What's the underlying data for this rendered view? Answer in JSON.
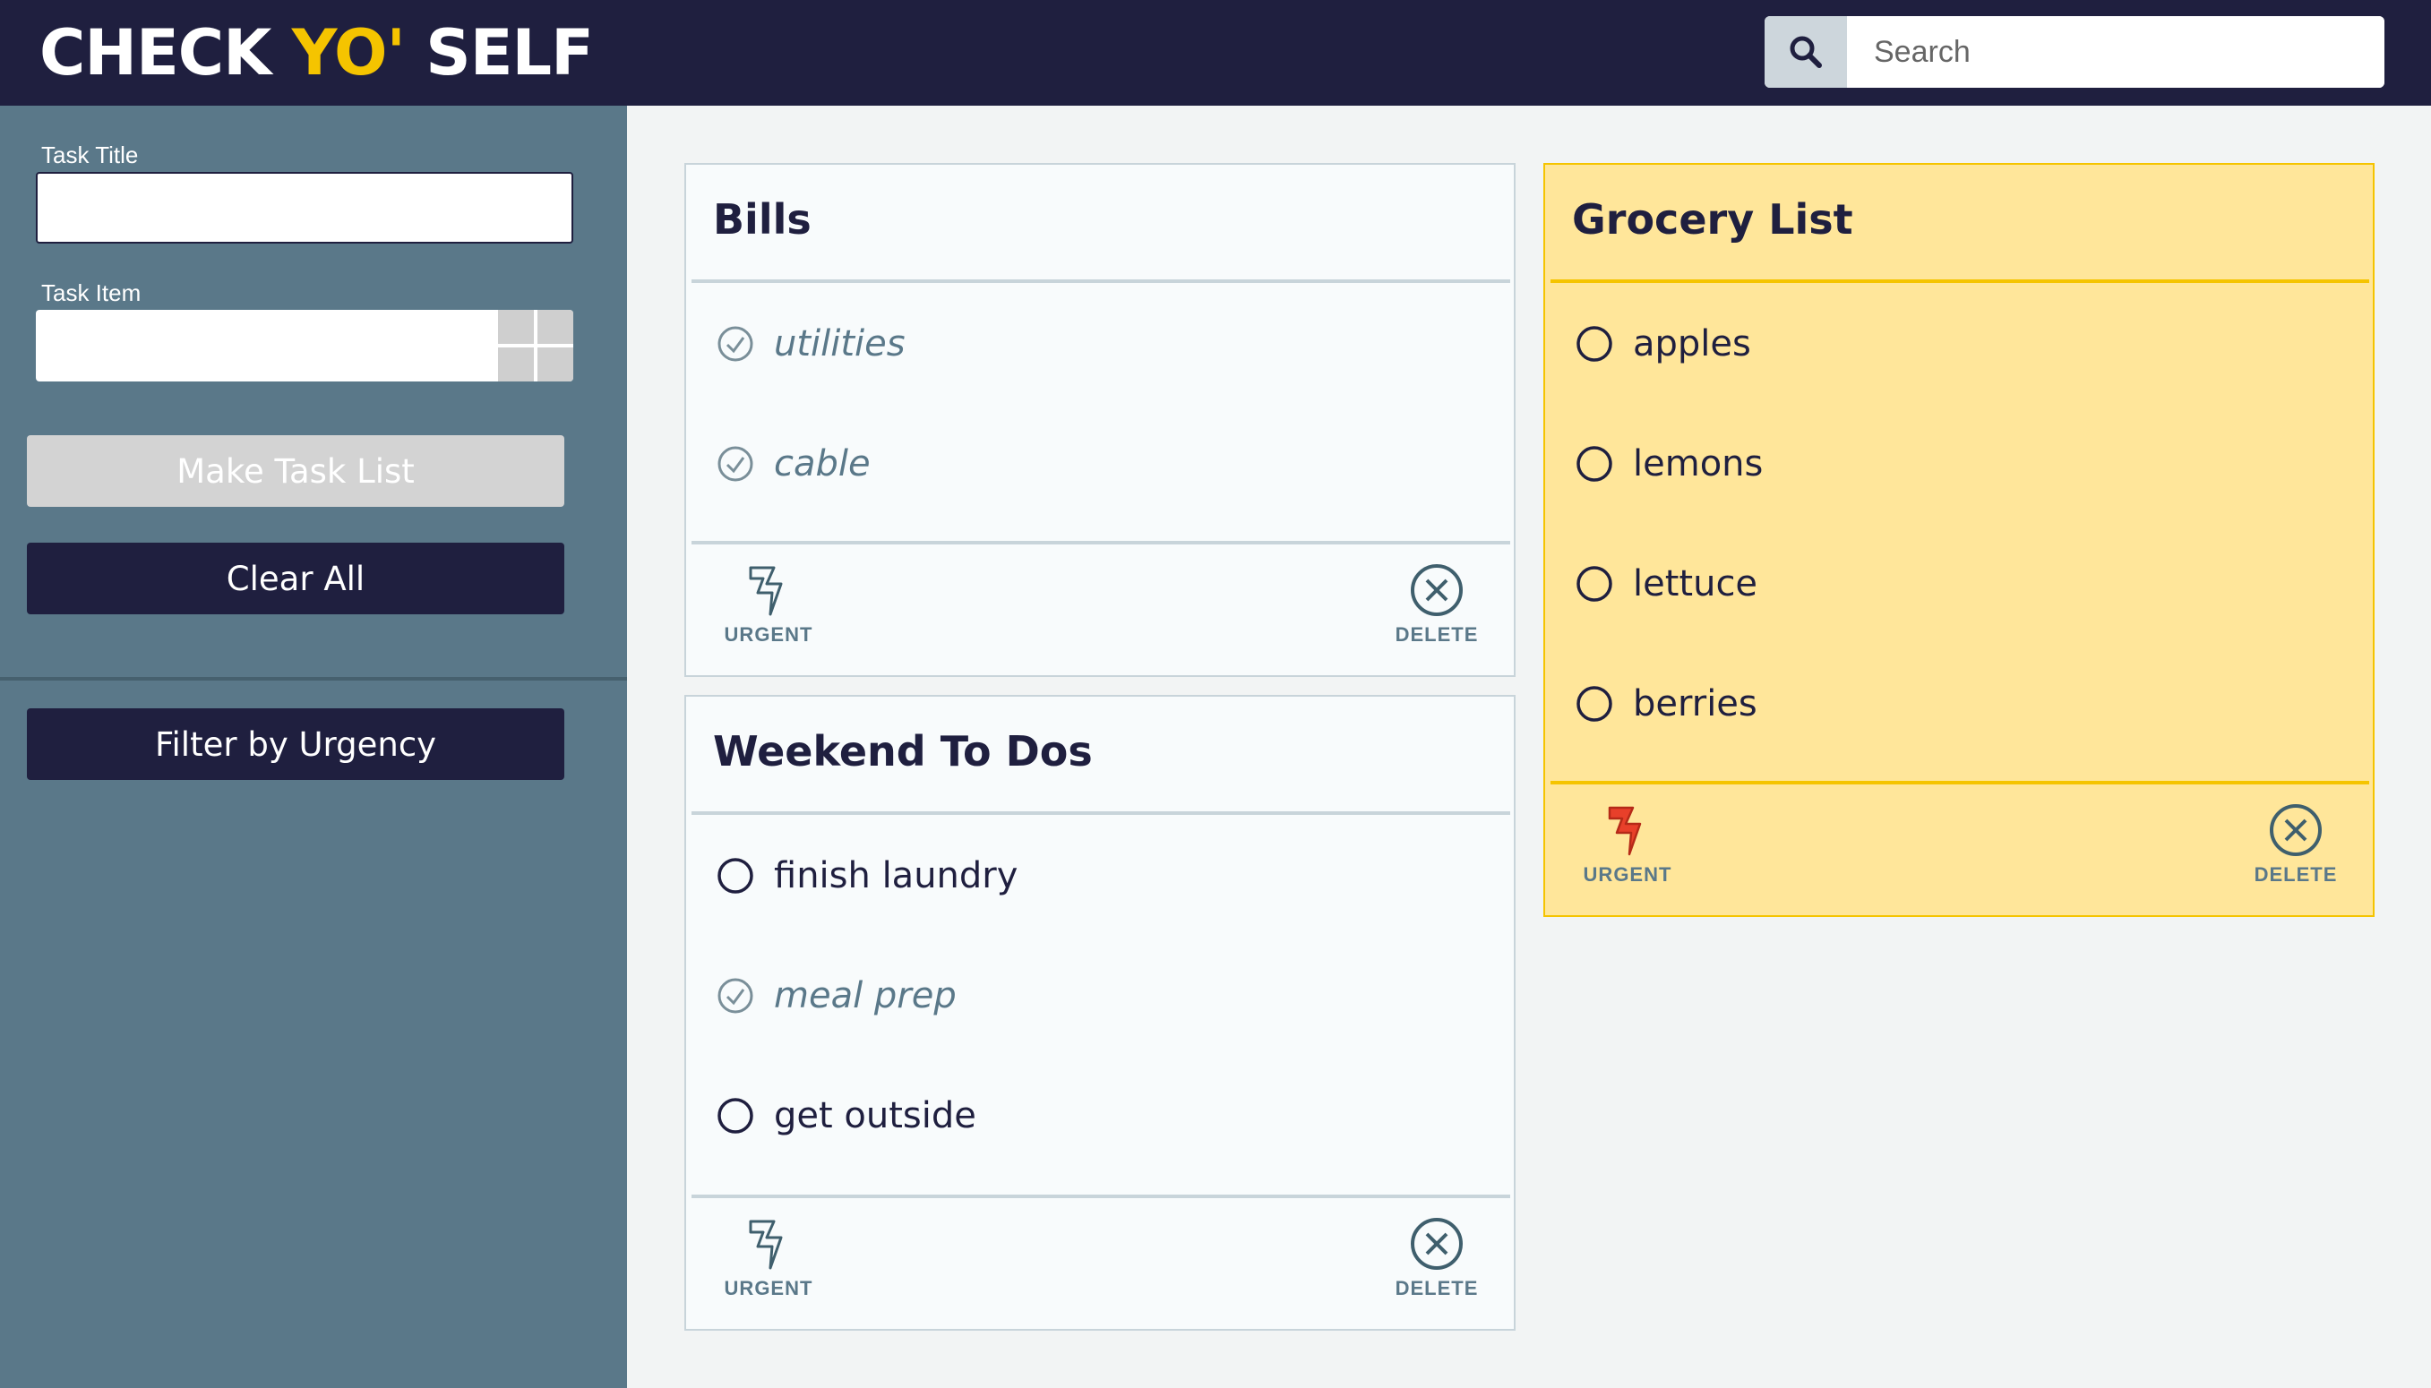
{
  "app": {
    "title_part1": "CHECK ",
    "title_accent": "YO'",
    "title_part2": " SELF"
  },
  "search": {
    "placeholder": "Search",
    "icon": "search-icon"
  },
  "sidebar": {
    "task_title_label": "Task Title",
    "task_item_label": "Task Item",
    "add_item_icon": "plus-icon",
    "make_task_list_label": "Make Task List",
    "clear_all_label": "Clear All",
    "filter_label": "Filter by Urgency"
  },
  "colors": {
    "header": "#1f1f3f",
    "accent": "#f5c400",
    "sidebar": "#5a7889",
    "urgent_card": "#ffe69a",
    "urgent_icon": "#e8402a"
  },
  "cards": [
    {
      "title": "Bills",
      "urgent": false,
      "items": [
        {
          "text": "utilities",
          "done": true
        },
        {
          "text": "cable",
          "done": true
        }
      ],
      "urgent_label": "URGENT",
      "delete_label": "DELETE"
    },
    {
      "title": "Weekend To Dos",
      "urgent": false,
      "items": [
        {
          "text": "finish laundry",
          "done": false
        },
        {
          "text": "meal prep",
          "done": true
        },
        {
          "text": "get outside",
          "done": false
        }
      ],
      "urgent_label": "URGENT",
      "delete_label": "DELETE"
    },
    {
      "title": "Grocery List",
      "urgent": true,
      "items": [
        {
          "text": "apples",
          "done": false
        },
        {
          "text": "lemons",
          "done": false
        },
        {
          "text": "lettuce",
          "done": false
        },
        {
          "text": "berries",
          "done": false
        }
      ],
      "urgent_label": "URGENT",
      "delete_label": "DELETE"
    }
  ]
}
